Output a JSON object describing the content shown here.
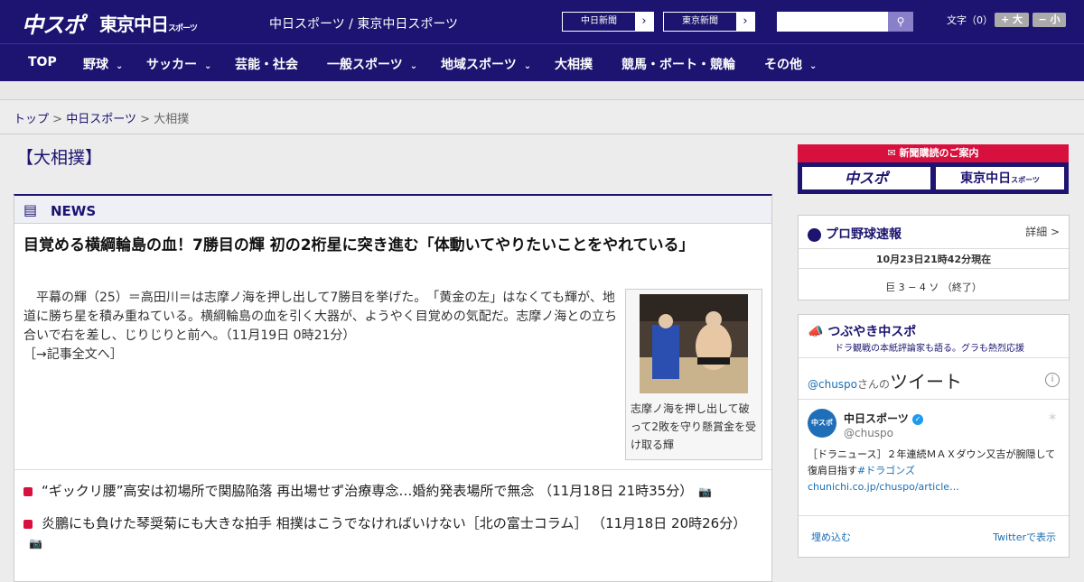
{
  "header": {
    "logo_chuspo": "中スポ",
    "logo_tokyo": "東京中日",
    "logo_tokyo_small": "スポーツ",
    "site_title": "中日スポーツ / 東京中日スポーツ",
    "ext_buttons": [
      "中日新聞",
      "東京新聞"
    ],
    "font_label": "文字（0）",
    "font_plus": "+ 大",
    "font_minus": "− 小"
  },
  "nav": [
    "TOP",
    "野球",
    "サッカー",
    "芸能・社会",
    "一般スポーツ",
    "地域スポーツ",
    "大相撲",
    "競馬・ボート・競輪",
    "その他"
  ],
  "breadcrumb": {
    "home": "トップ",
    "section": "中日スポーツ",
    "current": "大相撲",
    "sep": ">"
  },
  "category_title": "【大相撲】",
  "news": {
    "label": "NEWS",
    "headline": "目覚める横綱輪島の血！7勝目の輝 初の2桁星に突き進む「体動いてやりたいことをやれている」",
    "lead": "　平幕の輝（25）＝高田川＝は志摩ノ海を押し出して7勝目を挙げた。　「黄金の左」はなくても輝が、地道に勝ち星を積み重ねている。横綱輪島の血を引く大器が、ようやく目覚めの気配だ。志摩ノ海との立ち合いで右を差し、じりじりと前へ。（11月19日 0時21分）",
    "more": "［→記事全文へ］",
    "caption": "志摩ノ海を押し出して破って2敗を守り懸賞金を受け取る輝",
    "items": [
      "“ギックリ腰”高安は初場所で関脇陥落 再出場せず治療専念…婚約発表場所で無念 （11月18日 21時35分）",
      "炎鵬にも負けた琴奨菊にも大きな拍手 相撲はこうでなければいけない［北の富士コラム］ （11月18日 20時26分）"
    ]
  },
  "sidebar": {
    "subscription": {
      "head": "新聞購読のご案内",
      "btn1": "中スポ",
      "btn2": "東京中日",
      "btn2_small": "スポーツ"
    },
    "baseball": {
      "title": "プロ野球速報",
      "detail": "詳細 >",
      "time": "10月23日21時42分現在",
      "score": "巨 3 − 4 ソ （終了）"
    },
    "twitter": {
      "title": "つぶやき中スポ",
      "subtitle": "ドラ観戦の本紙評論家も語る。グラも熱烈応援",
      "handle_link": "@chuspo",
      "handle_suffix": "さんの",
      "tweets_word": "ツイート",
      "account_name": "中日スポーツ",
      "account_handle": "@chuspo",
      "avatar_text": "中スポ",
      "tweet_text": "［ドラニュース］２年連続ＭＡＸダウン又吉が腕隠して復肩目指す",
      "tweet_hashtag": "#ドラゴンズ",
      "tweet_link": "chunichi.co.jp/chuspo/article…",
      "embed": "埋め込む",
      "view_on": "Twitterで表示"
    }
  }
}
